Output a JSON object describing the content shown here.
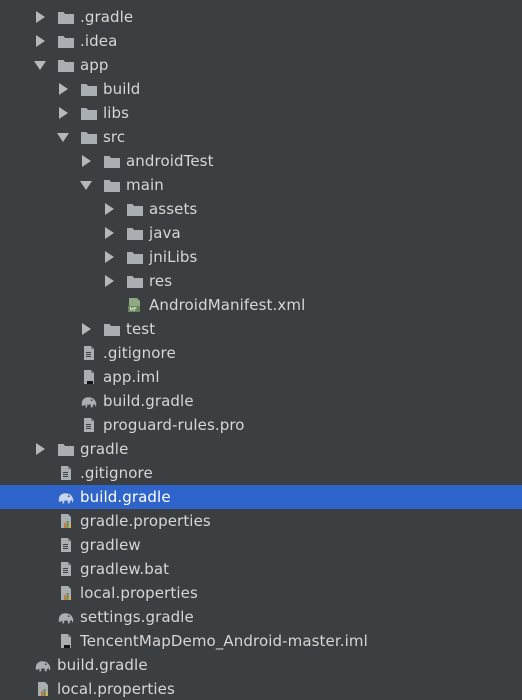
{
  "colors": {
    "background": "#3c3f41",
    "text": "#d6d6d6",
    "selection": "#2f65ca",
    "folder": "#a9aeb3",
    "arrow": "#b4b8bb",
    "manifest_badge": "#6a8759"
  },
  "project_tree": {
    "items": [
      {
        "label": ".gradle",
        "depth": 0,
        "icon": "folder-icon",
        "arrow": "collapsed",
        "selected": false
      },
      {
        "label": ".idea",
        "depth": 0,
        "icon": "folder-icon",
        "arrow": "collapsed",
        "selected": false
      },
      {
        "label": "app",
        "depth": 0,
        "icon": "folder-icon",
        "arrow": "expanded",
        "selected": false
      },
      {
        "label": "build",
        "depth": 1,
        "icon": "folder-icon",
        "arrow": "collapsed",
        "selected": false
      },
      {
        "label": "libs",
        "depth": 1,
        "icon": "folder-icon",
        "arrow": "collapsed",
        "selected": false
      },
      {
        "label": "src",
        "depth": 1,
        "icon": "folder-icon",
        "arrow": "expanded",
        "selected": false
      },
      {
        "label": "androidTest",
        "depth": 2,
        "icon": "folder-icon",
        "arrow": "collapsed",
        "selected": false
      },
      {
        "label": "main",
        "depth": 2,
        "icon": "folder-icon",
        "arrow": "expanded",
        "selected": false
      },
      {
        "label": "assets",
        "depth": 3,
        "icon": "folder-icon",
        "arrow": "collapsed",
        "selected": false
      },
      {
        "label": "java",
        "depth": 3,
        "icon": "folder-icon",
        "arrow": "collapsed",
        "selected": false
      },
      {
        "label": "jniLibs",
        "depth": 3,
        "icon": "folder-icon",
        "arrow": "collapsed",
        "selected": false
      },
      {
        "label": "res",
        "depth": 3,
        "icon": "folder-icon",
        "arrow": "collapsed",
        "selected": false
      },
      {
        "label": "AndroidManifest.xml",
        "depth": 3,
        "icon": "manifest-file-icon",
        "arrow": "none",
        "selected": false
      },
      {
        "label": "test",
        "depth": 2,
        "icon": "folder-icon",
        "arrow": "collapsed",
        "selected": false
      },
      {
        "label": ".gitignore",
        "depth": 1,
        "icon": "text-file-icon",
        "arrow": "none",
        "selected": false
      },
      {
        "label": "app.iml",
        "depth": 1,
        "icon": "iml-file-icon",
        "arrow": "none",
        "selected": false
      },
      {
        "label": "build.gradle",
        "depth": 1,
        "icon": "gradle-elephant-icon",
        "arrow": "none",
        "selected": false
      },
      {
        "label": "proguard-rules.pro",
        "depth": 1,
        "icon": "text-file-icon",
        "arrow": "none",
        "selected": false
      },
      {
        "label": "gradle",
        "depth": 0,
        "icon": "folder-icon",
        "arrow": "collapsed",
        "selected": false
      },
      {
        "label": ".gitignore",
        "depth": 0,
        "icon": "text-file-icon",
        "arrow": "none",
        "selected": false
      },
      {
        "label": "build.gradle",
        "depth": 0,
        "icon": "gradle-elephant-icon",
        "arrow": "none",
        "selected": true
      },
      {
        "label": "gradle.properties",
        "depth": 0,
        "icon": "properties-file-icon",
        "arrow": "none",
        "selected": false
      },
      {
        "label": "gradlew",
        "depth": 0,
        "icon": "text-file-icon",
        "arrow": "none",
        "selected": false
      },
      {
        "label": "gradlew.bat",
        "depth": 0,
        "icon": "text-file-icon",
        "arrow": "none",
        "selected": false
      },
      {
        "label": "local.properties",
        "depth": 0,
        "icon": "properties-file-icon",
        "arrow": "none",
        "selected": false
      },
      {
        "label": "settings.gradle",
        "depth": 0,
        "icon": "gradle-elephant-icon",
        "arrow": "none",
        "selected": false
      },
      {
        "label": "TencentMapDemo_Android-master.iml",
        "depth": 0,
        "icon": "iml-file-icon",
        "arrow": "none",
        "selected": false
      },
      {
        "label": "build.gradle",
        "depth": -1,
        "icon": "gradle-elephant-icon",
        "arrow": "none",
        "selected": false
      },
      {
        "label": "local.properties",
        "depth": -1,
        "icon": "properties-file-icon",
        "arrow": "none",
        "selected": false
      }
    ]
  }
}
